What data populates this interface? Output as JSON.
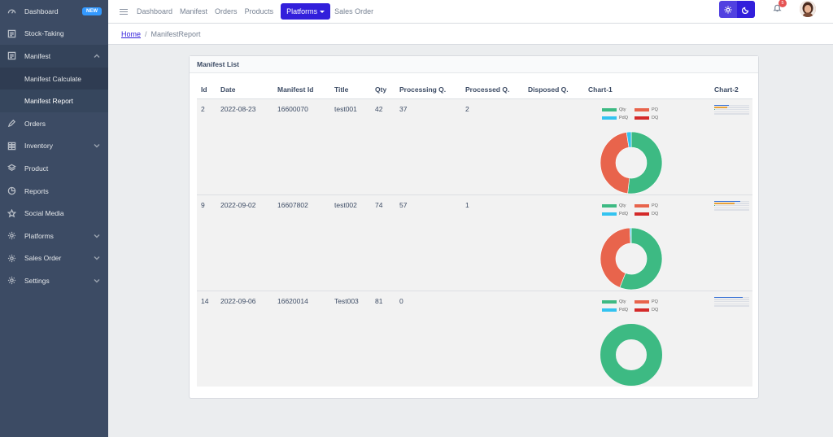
{
  "sidebar": {
    "items": [
      {
        "label": "Dashboard",
        "icon": "speedometer-icon",
        "badge": "NEW"
      },
      {
        "label": "Stock-Taking",
        "icon": "notes-icon"
      },
      {
        "label": "Manifest",
        "icon": "notes-icon",
        "expanded": true,
        "children": [
          {
            "label": "Manifest Calculate"
          },
          {
            "label": "Manifest Report",
            "active": true
          }
        ]
      },
      {
        "label": "Orders",
        "icon": "pencil-icon"
      },
      {
        "label": "Inventory",
        "icon": "grid-icon",
        "has_children": true
      },
      {
        "label": "Product",
        "icon": "layers-icon"
      },
      {
        "label": "Reports",
        "icon": "chart-pie-icon"
      },
      {
        "label": "Social Media",
        "icon": "star-icon"
      },
      {
        "label": "Platforms",
        "icon": "settings-icon",
        "has_children": true
      },
      {
        "label": "Sales Order",
        "icon": "settings-icon",
        "has_children": true
      },
      {
        "label": "Settings",
        "icon": "settings-icon",
        "has_children": true
      }
    ]
  },
  "header": {
    "nav": [
      "Dashboard",
      "Manifest",
      "Orders",
      "Products"
    ],
    "platforms_label": "Platforms",
    "sales_order_label": "Sales Order",
    "notification_count": "5"
  },
  "breadcrumb": {
    "home": "Home",
    "separator": "/",
    "current": "ManifestReport"
  },
  "card": {
    "title": "Manifest List",
    "columns": [
      "Id",
      "Date",
      "Manifest Id",
      "Title",
      "Qty",
      "Processing Q.",
      "Processed Q.",
      "Disposed Q.",
      "Chart-1",
      "Chart-2"
    ],
    "rows": [
      {
        "id": "2",
        "date": "2022-08-23",
        "manifest_id": "16600070",
        "title": "test001",
        "qty": "42",
        "processing": "37",
        "processed": "2",
        "disposed": ""
      },
      {
        "id": "9",
        "date": "2022-09-02",
        "manifest_id": "16607802",
        "title": "test002",
        "qty": "74",
        "processing": "57",
        "processed": "1",
        "disposed": ""
      },
      {
        "id": "14",
        "date": "2022-09-06",
        "manifest_id": "16620014",
        "title": "Test003",
        "qty": "81",
        "processing": "0",
        "processed": "",
        "disposed": ""
      }
    ]
  },
  "legend": {
    "qty": "Qty",
    "pq": "PQ",
    "pdq": "PdQ",
    "dq": "DQ"
  },
  "colors": {
    "qty": "#3dba83",
    "pq": "#e8644c",
    "pdq": "#33c3f0",
    "dq": "#d42a2a",
    "primary": "#321fdb",
    "sidebar": "#3c4b64"
  }
}
